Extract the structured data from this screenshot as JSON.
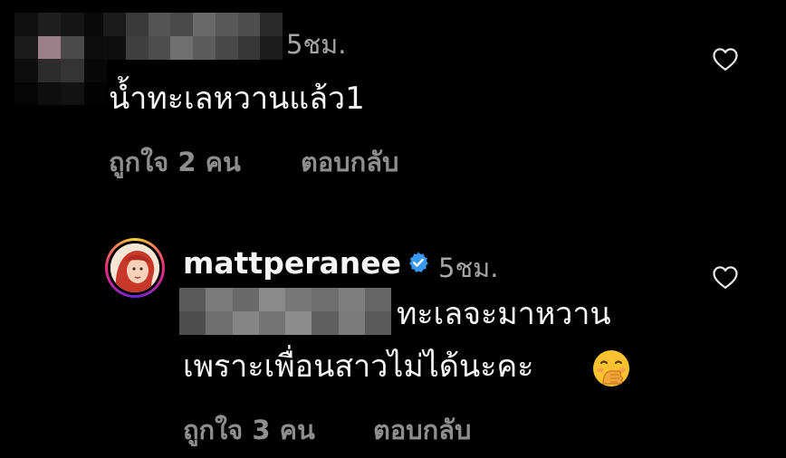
{
  "comments": [
    {
      "time": "5ชม.",
      "text": "น้ำทะเลหวานแล้ว1",
      "likes": "ถูกใจ 2 คน",
      "reply_label": "ตอบกลับ",
      "icons": {
        "like": "heart-outline-icon"
      }
    },
    {
      "username": "mattperanee",
      "verified": true,
      "time": "5ชม.",
      "text_line1": "ทะเลจะมาหวาน",
      "text_line2": "เพราะเพื่อนสาวไม่ได้นะคะ",
      "emoji": "face-with-hand-over-mouth",
      "likes": "ถูกใจ 3 คน",
      "reply_label": "ตอบกลับ",
      "icons": {
        "like": "heart-outline-icon",
        "badge": "verified-badge-icon"
      }
    }
  ],
  "colors": {
    "background": "#000000",
    "text": "#f5f5f5",
    "muted": "#8e8e8e",
    "verified": "#0095f6"
  }
}
